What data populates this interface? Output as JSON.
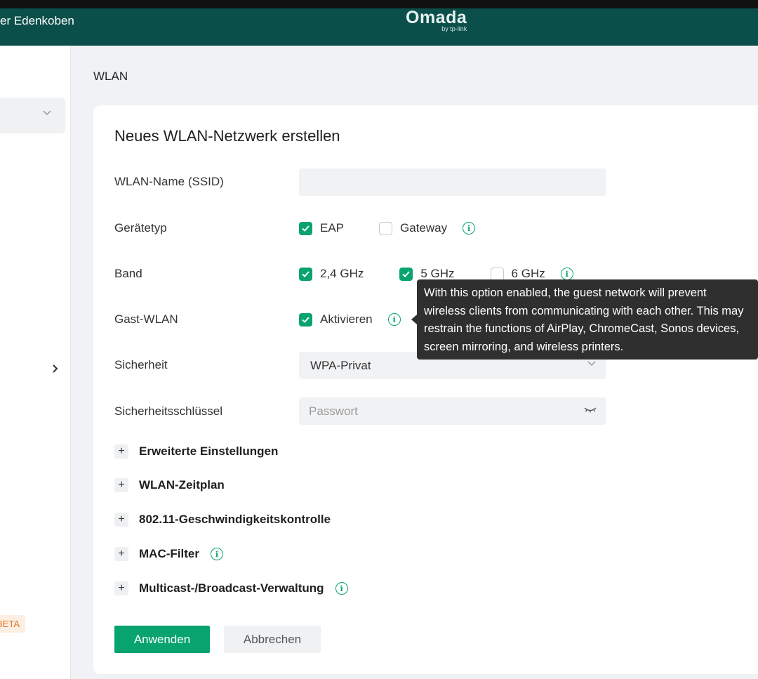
{
  "header": {
    "site_name": "er Edenkoben",
    "logo_text": "Omada",
    "logo_sub": "by tp-link"
  },
  "sidebar": {
    "beta_badge": "BETA"
  },
  "page": {
    "title": "WLAN"
  },
  "form": {
    "title": "Neues WLAN-Netzwerk erstellen",
    "ssid": {
      "label": "WLAN-Name (SSID)",
      "value": ""
    },
    "device_type": {
      "label": "Gerätetyp",
      "options": [
        {
          "label": "EAP",
          "checked": true
        },
        {
          "label": "Gateway",
          "checked": false
        }
      ]
    },
    "band": {
      "label": "Band",
      "options": [
        {
          "label": "2,4 GHz",
          "checked": true
        },
        {
          "label": "5 GHz",
          "checked": true
        },
        {
          "label": "6 GHz",
          "checked": false
        }
      ]
    },
    "guest": {
      "label": "Gast-WLAN",
      "option": {
        "label": "Aktivieren",
        "checked": true
      }
    },
    "security": {
      "label": "Sicherheit",
      "value": "WPA-Privat"
    },
    "key": {
      "label": "Sicherheitsschlüssel",
      "placeholder": "Passwort"
    },
    "expanders": [
      {
        "label": "Erweiterte Einstellungen"
      },
      {
        "label": "WLAN-Zeitplan"
      },
      {
        "label": "802.11-Geschwindigkeitskontrolle"
      },
      {
        "label": "MAC-Filter"
      },
      {
        "label": "Multicast-/Broadcast-Verwaltung"
      }
    ],
    "apply_label": "Anwenden",
    "cancel_label": "Abbrechen"
  },
  "tooltip": {
    "text": "With this option enabled, the guest network will prevent wireless clients from communicating with each other. This may restrain the functions of AirPlay, ChromeCast, Sonos devices, screen mirroring, and wireless printers."
  },
  "colors": {
    "header": "#0b4f4a",
    "accent": "#08a36f",
    "tooltip_bg": "#2f2f2f"
  },
  "icons": [
    "info-icon",
    "check-icon",
    "chevron-down-icon",
    "chevron-right-icon",
    "plus-icon",
    "eye-closed-icon"
  ]
}
